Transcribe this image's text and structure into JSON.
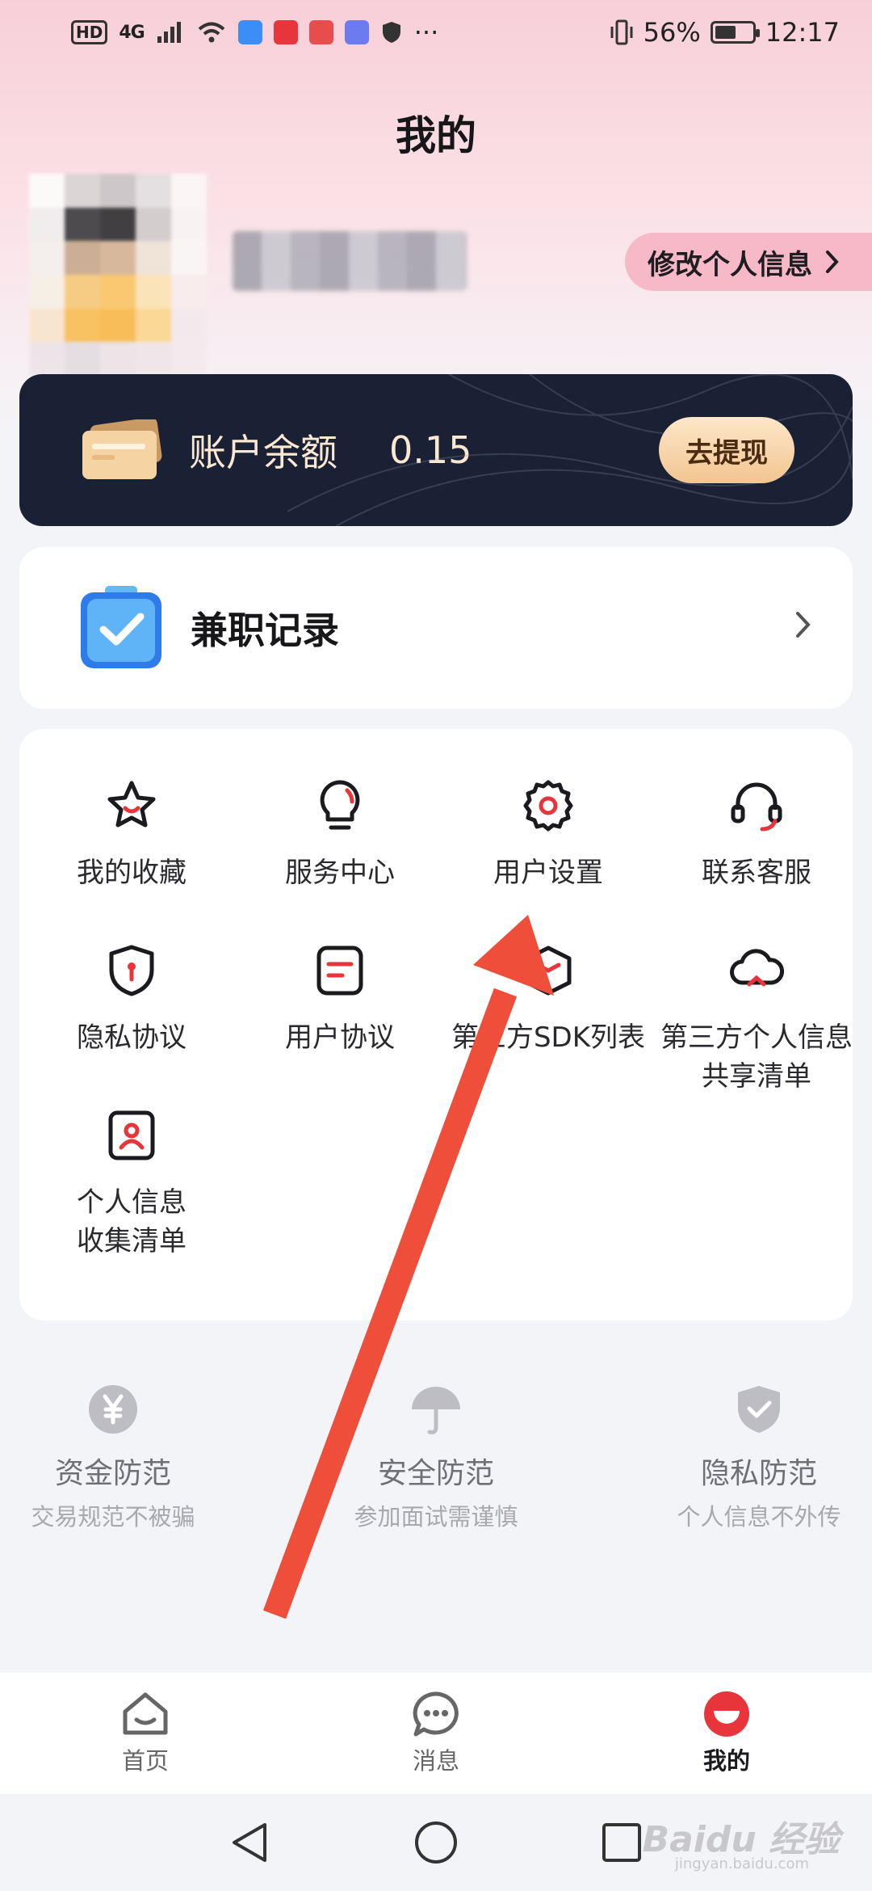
{
  "status_bar": {
    "hd": "HD",
    "network": "4G",
    "more": "···",
    "battery_text": "56%",
    "battery_level": 0.56,
    "time": "12:17"
  },
  "page_title": "我的",
  "profile": {
    "edit_label": "修改个人信息"
  },
  "balance": {
    "label": "账户余额",
    "value": "0.15",
    "withdraw_label": "去提现"
  },
  "record": {
    "label": "兼职记录"
  },
  "menu": [
    {
      "label": "我的收藏",
      "icon": "star-icon"
    },
    {
      "label": "服务中心",
      "icon": "bulb-icon"
    },
    {
      "label": "用户设置",
      "icon": "gear-icon"
    },
    {
      "label": "联系客服",
      "icon": "headset-icon"
    },
    {
      "label": "隐私协议",
      "icon": "shield-icon"
    },
    {
      "label": "用户协议",
      "icon": "document-icon"
    },
    {
      "label": "第三方SDK列表",
      "icon": "cube-icon"
    },
    {
      "label": "第三方个人信息\n共享清单",
      "icon": "cloud-icon"
    },
    {
      "label": "个人信息\n收集清单",
      "icon": "id-card-icon"
    }
  ],
  "tips": [
    {
      "title": "资金防范",
      "subtitle": "交易规范不被骗",
      "icon": "yen-icon"
    },
    {
      "title": "安全防范",
      "subtitle": "参加面试需谨慎",
      "icon": "umbrella-icon"
    },
    {
      "title": "隐私防范",
      "subtitle": "个人信息不外传",
      "icon": "shield-check-icon"
    }
  ],
  "bottom_nav": [
    {
      "label": "首页",
      "icon": "home-icon",
      "active": false
    },
    {
      "label": "消息",
      "icon": "message-icon",
      "active": false
    },
    {
      "label": "我的",
      "icon": "profile-icon",
      "active": true
    }
  ],
  "watermark": {
    "brand": "Baidu 经验",
    "url": "jingyan.baidu.com"
  },
  "colors": {
    "accent": "#e8353b",
    "card_dark": "#1b2135",
    "annotation_arrow": "#ee4e3a"
  }
}
